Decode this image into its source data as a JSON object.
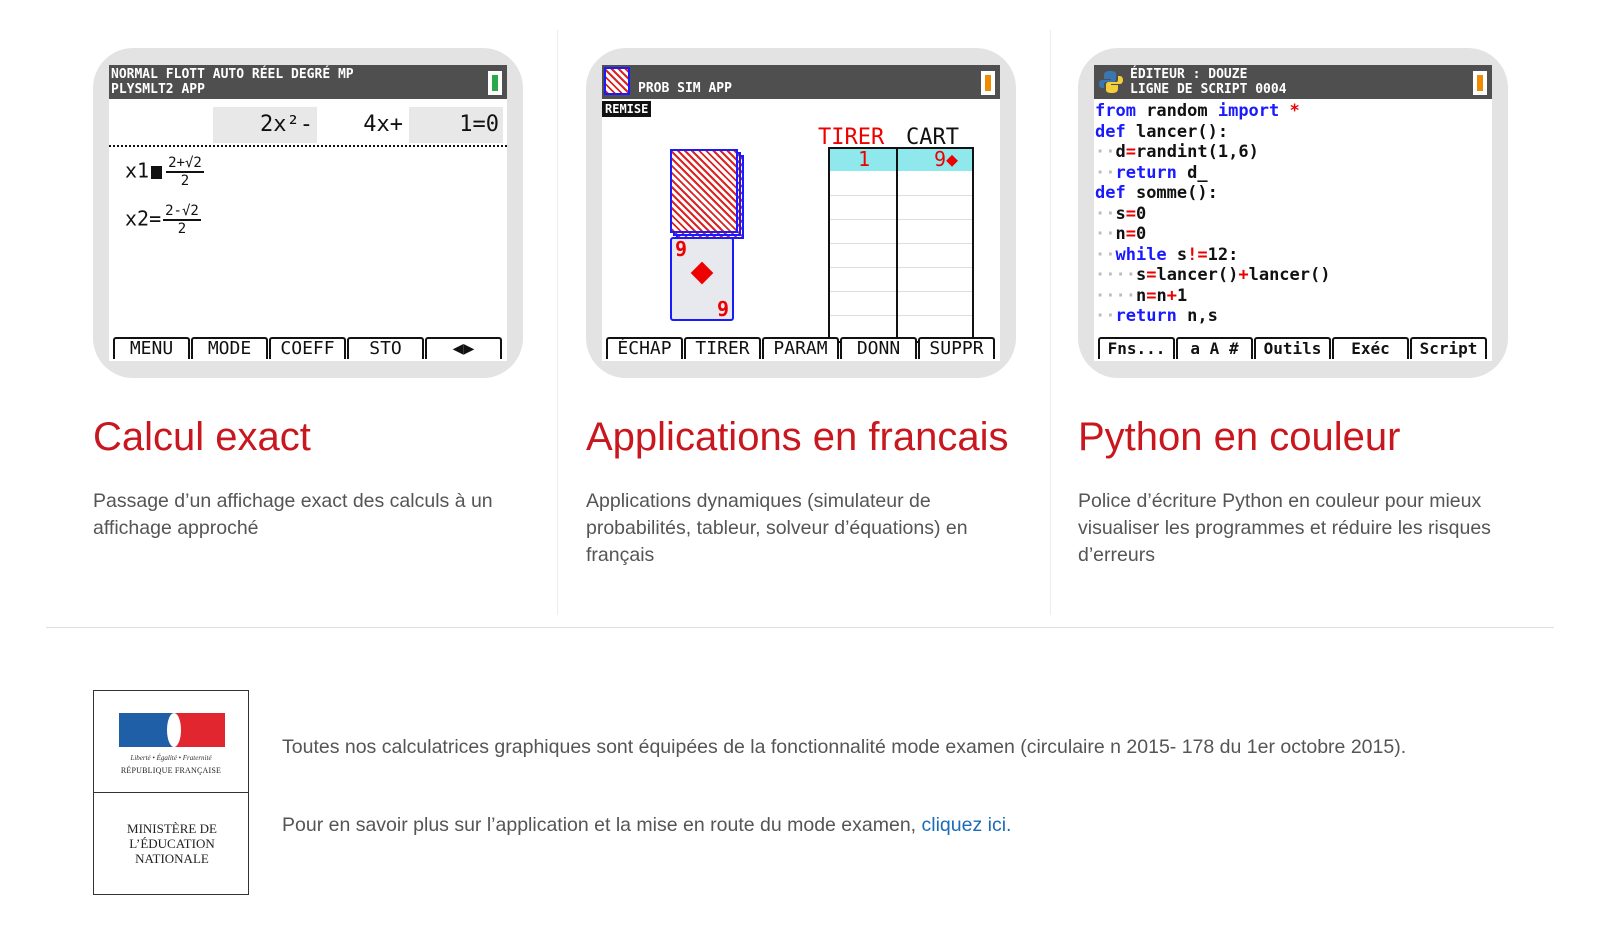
{
  "features": [
    {
      "title": "Calcul exact",
      "description": "Passage d’un affichage exact des calculs à un affichage approché",
      "screen": {
        "status_line1": "NORMAL FLOTT AUTO RÉEL DEGRÉ MP",
        "status_line2": "PLYSMLT2 APP",
        "equation": [
          "2x²-",
          "4x+",
          "1=0"
        ],
        "x1_label": "x1",
        "x1_num": "2+√2",
        "x1_den": "2",
        "x2_label": "x2=",
        "x2_num": "2-√2",
        "x2_den": "2",
        "softkeys": [
          "MENU",
          "MODE",
          "COEFF",
          "STO",
          "◀▶"
        ],
        "battery_color": "#2aa84a"
      }
    },
    {
      "title": "Applications en francais",
      "description": "Applications dynamiques (simulateur de probabilités, tableur, solveur d’équations) en français",
      "screen": {
        "status_line": "PROB SIM APP",
        "remise": "REMISE",
        "col_tirer": "TIRER",
        "col_cart": "CART",
        "row_tirer": "1",
        "row_cart": "9◆",
        "card_value": "9",
        "softkeys": [
          "ÉCHAP",
          "TIRER",
          "PARAM",
          "DONN",
          "SUPPR"
        ],
        "battery_color": "#f08a00"
      }
    },
    {
      "title": "Python en couleur",
      "description": "Police d’écriture Python en couleur pour mieux visualiser les programmes et réduire les risques d’erreurs",
      "screen": {
        "status_line1": "ÉDITEUR : DOUZE",
        "status_line2": "LIGNE DE SCRIPT 0004",
        "softkeys": [
          "Fns...",
          "a A #",
          "Outils",
          "Exéc",
          "Script"
        ],
        "battery_color": "#f08a00"
      }
    }
  ],
  "footer": {
    "logo_motto": "Liberté • Égalité • Fraternité",
    "logo_republique": "RÉPUBLIQUE FRANÇAISE",
    "logo_ministere": "MINISTÈRE DE L’ÉDUCATION NATIONALE",
    "exam_text": "Toutes nos calculatrices graphiques sont équipées de la fonctionnalité mode examen (circulaire n 2015- 178 du 1er octobre 2015).",
    "more_text": "Pour en savoir plus sur l’application et la mise en route du mode examen,",
    "link_text": "cliquez ici."
  }
}
